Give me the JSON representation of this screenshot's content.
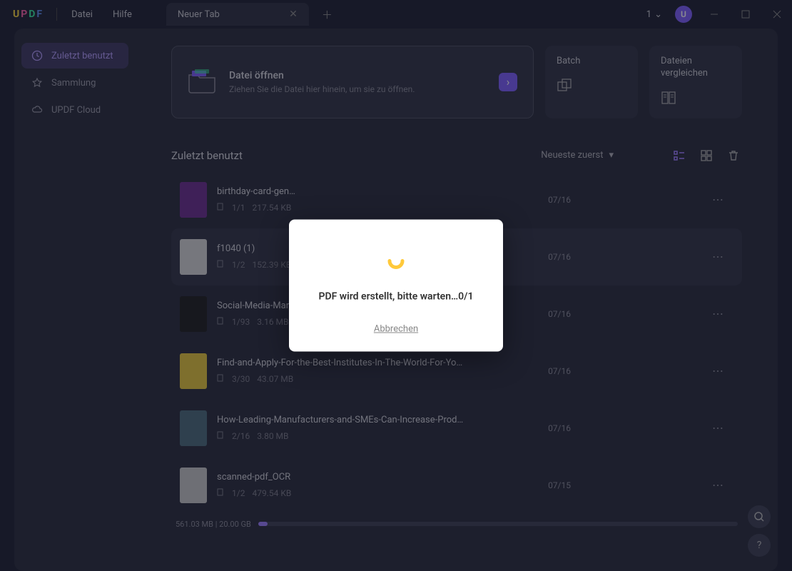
{
  "titlebar": {
    "menu": {
      "file": "Datei",
      "help": "Hilfe"
    },
    "tab": {
      "label": "Neuer Tab"
    },
    "count": "1",
    "avatar_initial": "U"
  },
  "sidebar": {
    "items": [
      {
        "label": "Zuletzt benutzt"
      },
      {
        "label": "Sammlung"
      },
      {
        "label": "UPDF Cloud"
      }
    ]
  },
  "open_card": {
    "title": "Datei öffnen",
    "subtitle": "Ziehen Sie die Datei hier hinein, um sie zu öffnen."
  },
  "batch_card": {
    "title": "Batch"
  },
  "compare_card": {
    "title": "Dateien vergleichen"
  },
  "list": {
    "title": "Zuletzt benutzt",
    "sort": "Neueste zuerst"
  },
  "files": [
    {
      "name": "birthday-card-gen…",
      "pages": "1/1",
      "size": "217.54 KB",
      "date": "07/16",
      "thumb_bg": "#6b2a8f"
    },
    {
      "name": "f1040 (1)",
      "pages": "1/2",
      "size": "152.39 KB",
      "date": "07/16",
      "thumb_bg": "#d8d8d8"
    },
    {
      "name": "Social-Media-Mark…",
      "pages": "1/93",
      "size": "3.16 MB",
      "date": "07/16",
      "thumb_bg": "#1a1a1a"
    },
    {
      "name": "Find-and-Apply-For-the-Best-Institutes-In-The-World-For-Your…",
      "pages": "3/30",
      "size": "43.07 MB",
      "date": "07/16",
      "thumb_bg": "#e8c838"
    },
    {
      "name": "How-Leading-Manufacturers-and-SMEs-Can-Increase-Producti…",
      "pages": "2/16",
      "size": "3.80 MB",
      "date": "07/16",
      "thumb_bg": "#4a6a7a"
    },
    {
      "name": "scanned-pdf_OCR",
      "pages": "1/2",
      "size": "479.54 KB",
      "date": "07/15",
      "thumb_bg": "#c8c8c8"
    }
  ],
  "storage": {
    "used": "561.03 MB",
    "total": "20.00 GB"
  },
  "modal": {
    "message": "PDF wird erstellt, bitte warten…0/1",
    "cancel": "Abbrechen"
  }
}
